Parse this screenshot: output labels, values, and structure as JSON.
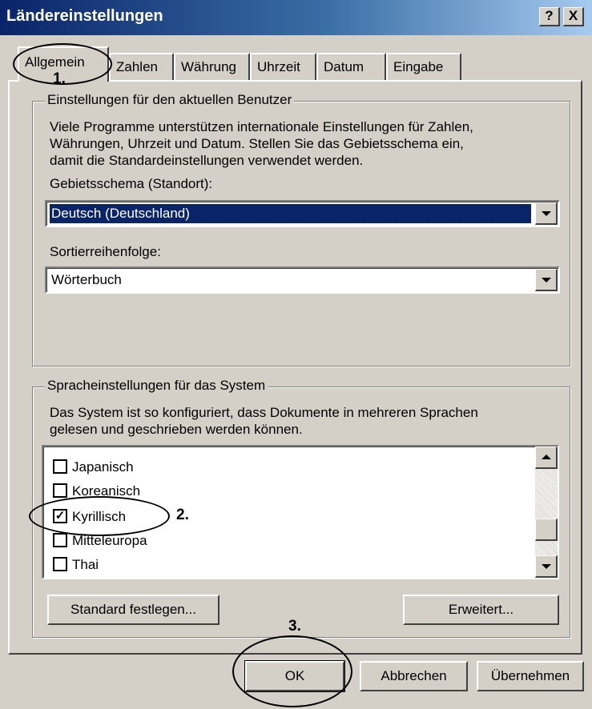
{
  "window": {
    "title": "Ländereinstellungen",
    "help_label": "?",
    "close_label": "X"
  },
  "tabs": [
    {
      "label": "Allgemein",
      "active": true
    },
    {
      "label": "Zahlen",
      "active": false
    },
    {
      "label": "Währung",
      "active": false
    },
    {
      "label": "Uhrzeit",
      "active": false
    },
    {
      "label": "Datum",
      "active": false
    },
    {
      "label": "Eingabe",
      "active": false
    }
  ],
  "user_settings": {
    "group_title": "Einstellungen für den aktuellen Benutzer",
    "description_lines": [
      "Viele Programme unterstützen internationale Einstellungen für Zahlen,",
      "Währungen, Uhrzeit und Datum. Stellen Sie das Gebietsschema ein,",
      "damit die Standardeinstellungen verwendet werden."
    ],
    "locale_label": "Gebietsschema (Standort):",
    "locale_value": "Deutsch (Deutschland)",
    "sort_label": "Sortierreihenfolge:",
    "sort_value": "Wörterbuch"
  },
  "system_settings": {
    "group_title": "Spracheinstellungen für das System",
    "description_lines": [
      "Das System ist so konfiguriert, dass Dokumente in mehreren Sprachen",
      "gelesen und geschrieben werden können."
    ],
    "languages": [
      {
        "label": "Japanisch",
        "checked": false
      },
      {
        "label": "Koreanisch",
        "checked": false
      },
      {
        "label": "Kyrillisch",
        "checked": true
      },
      {
        "label": "Mitteleuropa",
        "checked": false
      },
      {
        "label": "Thai",
        "checked": false
      }
    ],
    "set_default_label": "Standard festlegen...",
    "advanced_label": "Erweitert..."
  },
  "footer": {
    "ok_label": "OK",
    "cancel_label": "Abbrechen",
    "apply_label": "Übernehmen"
  },
  "annotations": {
    "step1": "1.",
    "step2": "2.",
    "step3": "3."
  },
  "colors": {
    "titlebar_start": "#0a246a",
    "titlebar_end": "#a6caf0",
    "selection": "#0a246a",
    "dialog_face": "#d4d0c8"
  }
}
